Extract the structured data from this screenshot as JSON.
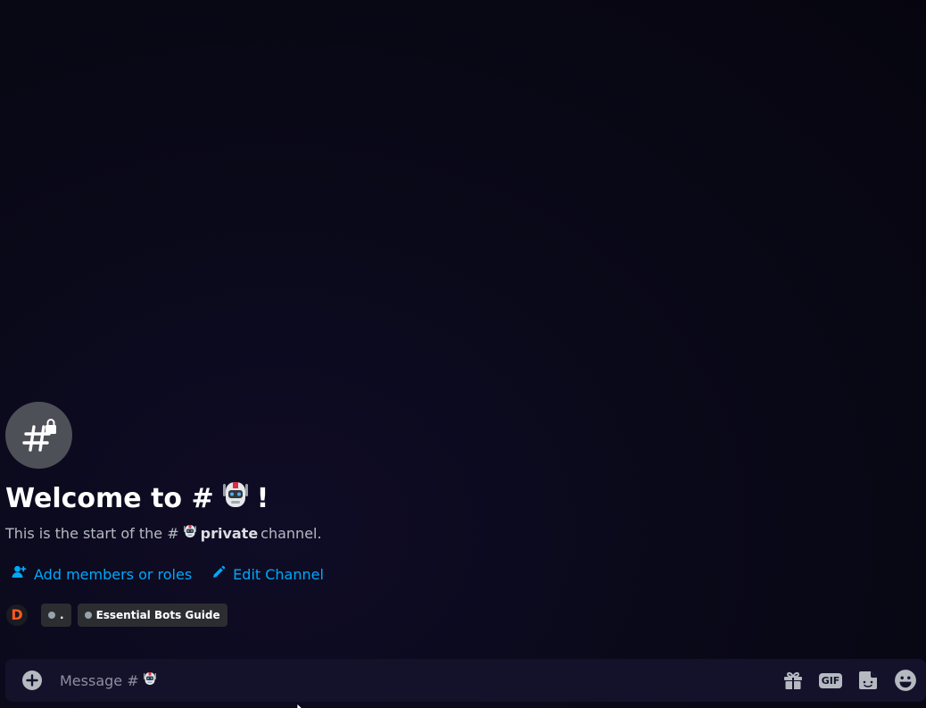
{
  "channel": {
    "welcome_prefix": "Welcome to #",
    "welcome_suffix": "!",
    "desc_prefix": "This is the start of the #",
    "desc_channel_name": "private",
    "desc_suffix": "channel."
  },
  "actions": {
    "add_members_label": "Add members or roles",
    "edit_channel_label": "Edit Channel"
  },
  "tags": {
    "avatar_letter": "D",
    "tag1_label": ".",
    "tag2_label": "Essential Bots Guide"
  },
  "composer": {
    "placeholder_prefix": "Message #"
  },
  "icons": {
    "channel": "private-text-channel-icon",
    "add_members": "add-user-icon",
    "edit": "pencil-icon",
    "plus": "plus-circle-icon",
    "gift": "gift-icon",
    "gif": "gif-icon",
    "sticker": "sticker-icon",
    "emoji": "emoji-icon",
    "bot": "robot-emoji"
  },
  "colors": {
    "link": "#00a8fc",
    "avatar_letter": "#ff5a1f"
  }
}
